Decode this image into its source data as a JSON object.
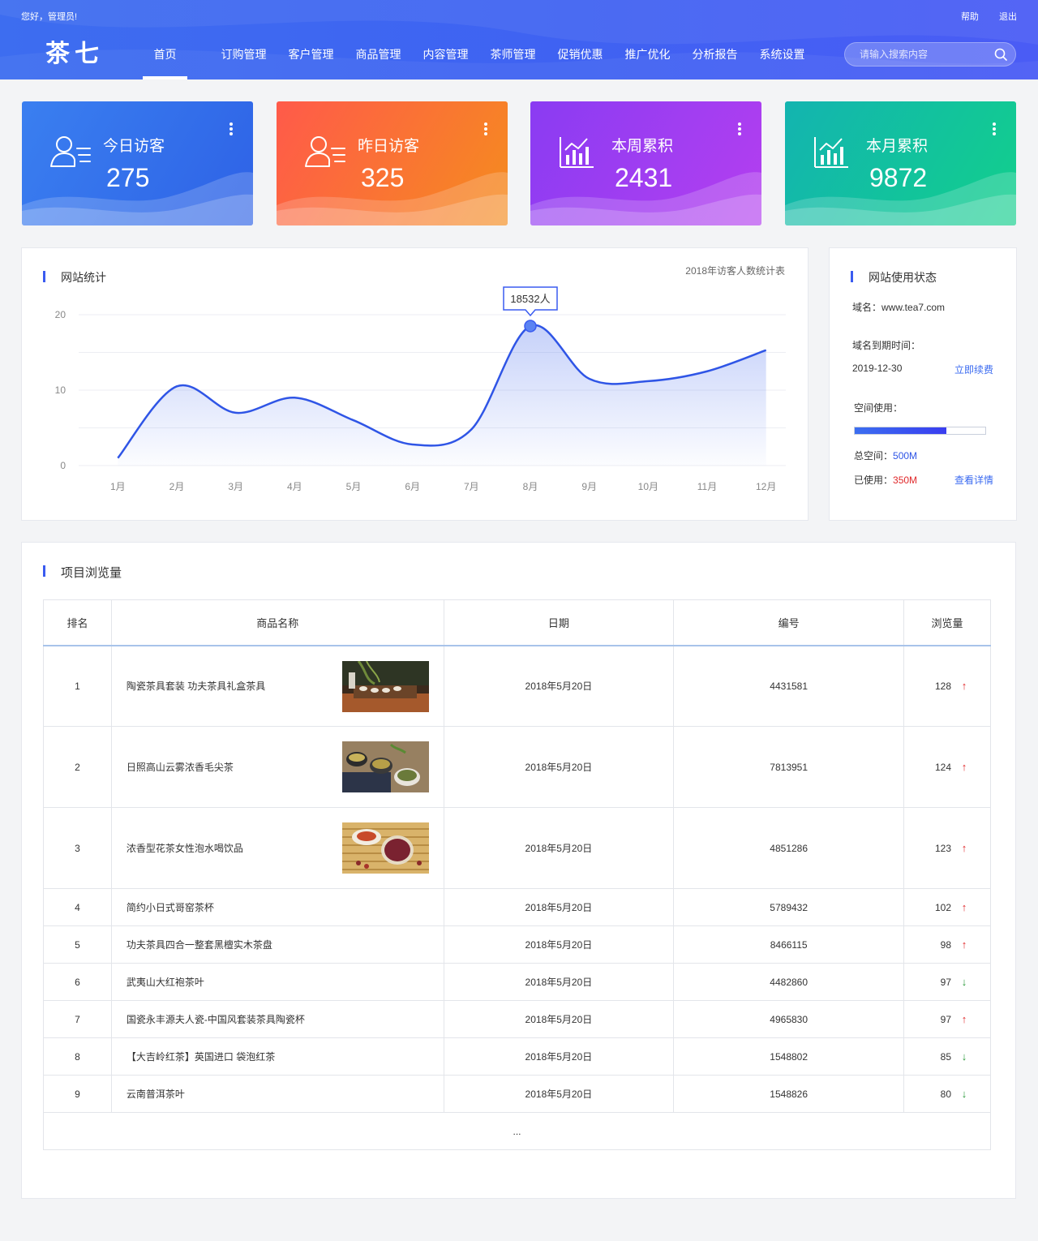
{
  "header": {
    "greeting": "您好，管理员!",
    "help": "帮助",
    "logout": "退出",
    "logo": "茶七",
    "nav": [
      {
        "label": "首页",
        "active": true
      },
      {
        "label": "订购管理"
      },
      {
        "label": "客户管理"
      },
      {
        "label": "商品管理"
      },
      {
        "label": "内容管理"
      },
      {
        "label": "茶师管理"
      },
      {
        "label": "促销优惠"
      },
      {
        "label": "推广优化"
      },
      {
        "label": "分析报告"
      },
      {
        "label": "系统设置"
      }
    ],
    "search_placeholder": "请输入搜索内容"
  },
  "cards": [
    {
      "label": "今日访客",
      "value": "275",
      "icon": "user-list-icon",
      "colors": [
        "#3a7ff0",
        "#2e62e6"
      ]
    },
    {
      "label": "昨日访客",
      "value": "325",
      "icon": "user-list-icon",
      "colors": [
        "#ff5a4a",
        "#f58c1e"
      ]
    },
    {
      "label": "本周累积",
      "value": "2431",
      "icon": "bar-chart-icon",
      "colors": [
        "#8a3cf2",
        "#b43ff0"
      ]
    },
    {
      "label": "本月累积",
      "value": "9872",
      "icon": "bar-chart-icon",
      "colors": [
        "#13b4b0",
        "#12cf8c"
      ]
    }
  ],
  "chart_panel": {
    "title": "网站统计",
    "subtitle": "2018年访客人数统计表"
  },
  "chart_data": {
    "type": "area",
    "categories": [
      "1月",
      "2月",
      "3月",
      "4月",
      "5月",
      "6月",
      "7月",
      "8月",
      "9月",
      "10月",
      "11月",
      "12月"
    ],
    "values": [
      1,
      10.5,
      7,
      9,
      6,
      2.8,
      4.8,
      18.5,
      11.5,
      11.2,
      12.5,
      15.3
    ],
    "ylim": [
      0,
      20
    ],
    "yticks": [
      0,
      10,
      20
    ],
    "highlight": {
      "index": 7,
      "label": "18532人"
    },
    "grid": true,
    "line_color": "#2f55e6"
  },
  "status": {
    "title": "网站使用状态",
    "domain_label": "域名：",
    "domain": "www.tea7.com",
    "expire_label": "域名到期时间：",
    "expire_date": "2019-12-30",
    "renew": "立即续费",
    "space_label": "空间使用：",
    "usage_fraction": 0.7,
    "total_label": "总空间：",
    "total_value": "500M",
    "used_label": "已使用：",
    "used_value": "350M",
    "details": "查看详情",
    "total_color": "#2f55e6",
    "used_color": "#e0282a"
  },
  "table": {
    "title": "项目浏览量",
    "headers": [
      "排名",
      "商品名称",
      "日期",
      "编号",
      "浏览量"
    ],
    "rows": [
      {
        "rank": "1",
        "name": "陶瓷茶具套装 功夫茶具礼盒茶具",
        "date": "2018年5月20日",
        "code": "4431581",
        "views": "128",
        "trend": "up",
        "thumb": "tea-set-photo"
      },
      {
        "rank": "2",
        "name": "日照高山云雾浓香毛尖茶",
        "date": "2018年5月20日",
        "code": "7813951",
        "views": "124",
        "trend": "up",
        "thumb": "green-tea-photo"
      },
      {
        "rank": "3",
        "name": "浓香型花茶女性泡水喝饮品",
        "date": "2018年5月20日",
        "code": "4851286",
        "views": "123",
        "trend": "up",
        "thumb": "flower-tea-photo"
      },
      {
        "rank": "4",
        "name": "简约小日式哥窑茶杯",
        "date": "2018年5月20日",
        "code": "5789432",
        "views": "102",
        "trend": "up"
      },
      {
        "rank": "5",
        "name": "功夫茶具四合一整套黑檀实木茶盘",
        "date": "2018年5月20日",
        "code": "8466115",
        "views": "98",
        "trend": "up"
      },
      {
        "rank": "6",
        "name": "武夷山大红袍茶叶",
        "date": "2018年5月20日",
        "code": "4482860",
        "views": "97",
        "trend": "down"
      },
      {
        "rank": "7",
        "name": "国瓷永丰源夫人瓷-中国风套装茶具陶瓷杯",
        "date": "2018年5月20日",
        "code": "4965830",
        "views": "97",
        "trend": "up"
      },
      {
        "rank": "8",
        "name": "【大吉岭红茶】英国进口 袋泡红茶",
        "date": "2018年5月20日",
        "code": "1548802",
        "views": "85",
        "trend": "down"
      },
      {
        "rank": "9",
        "name": "云南普洱茶叶",
        "date": "2018年5月20日",
        "code": "1548826",
        "views": "80",
        "trend": "down"
      }
    ],
    "more": "..."
  },
  "arrows": {
    "up": "↑",
    "down": "↓"
  }
}
